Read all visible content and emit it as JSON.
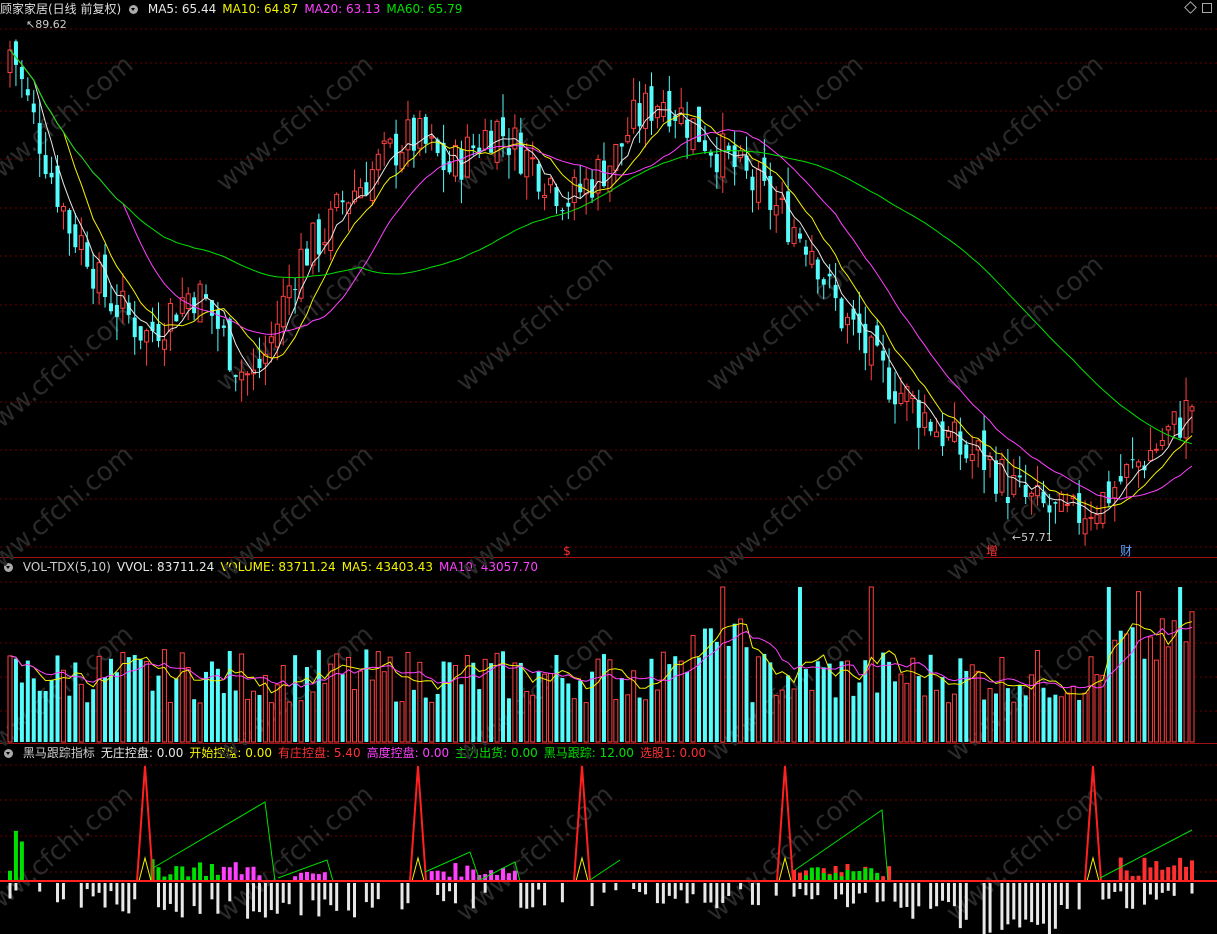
{
  "price_panel": {
    "stock_name": "顾家家居(日线 前复权)",
    "ma_labels": [
      {
        "text": "MA5: 65.44",
        "color": "#e8e8e8"
      },
      {
        "text": "MA10: 64.87",
        "color": "#f4f400"
      },
      {
        "text": "MA20: 63.13",
        "color": "#ff40ff"
      },
      {
        "text": "MA60: 65.79",
        "color": "#00e000"
      }
    ],
    "max_label": "89.62",
    "min_label": "57.71",
    "markers": [
      {
        "text": "$",
        "color": "#ff3030"
      },
      {
        "text": "增",
        "color": "#ff3030"
      },
      {
        "text": "财",
        "color": "#60a0ff"
      }
    ]
  },
  "volume_panel": {
    "labels": [
      {
        "text": "VOL-TDX(5,10)",
        "color": "#cccccc"
      },
      {
        "text": "VVOL: 83711.24",
        "color": "#e8e8e8"
      },
      {
        "text": "VOLUME: 83711.24",
        "color": "#f4f400"
      },
      {
        "text": "MA5: 43403.43",
        "color": "#f4f400"
      },
      {
        "text": "MA10: 43057.70",
        "color": "#ff40ff"
      }
    ]
  },
  "indicator_panel": {
    "labels": [
      {
        "text": "黑马跟踪指标",
        "color": "#cccccc"
      },
      {
        "text": "无庄控盘: 0.00",
        "color": "#e8e8e8"
      },
      {
        "text": "开始控盘: 0.00",
        "color": "#f4f400"
      },
      {
        "text": "有庄控盘: 5.40",
        "color": "#ff3030"
      },
      {
        "text": "高度控盘: 0.00",
        "color": "#ff40ff"
      },
      {
        "text": "主力出货: 0.00",
        "color": "#00e000"
      },
      {
        "text": "黑马跟踪: 12.00",
        "color": "#00e000"
      },
      {
        "text": "选股1: 0.00",
        "color": "#ff3030"
      }
    ]
  },
  "watermark": "www.cfchi.com",
  "colors": {
    "up": "#ff4040",
    "down": "#54fcfc",
    "grid": "#6a0000"
  },
  "chart_data": [
    {
      "type": "candlestick",
      "title": "顾家家居(日线 前复权)",
      "ylim": [
        57,
        91
      ],
      "price_max": 89.62,
      "price_min": 57.71,
      "close_series_approx": [
        89.6,
        86,
        83,
        80,
        77,
        76,
        73,
        72,
        71,
        70,
        71,
        72,
        73,
        72,
        70,
        68,
        67,
        69,
        72,
        75,
        76,
        77,
        79,
        80,
        81,
        82,
        83,
        83,
        82,
        81,
        82,
        83,
        84,
        83,
        82,
        81,
        80,
        79,
        80,
        81,
        82,
        84,
        85,
        86,
        85,
        84,
        83,
        82,
        81,
        80,
        79,
        78,
        77,
        76,
        73,
        71,
        70,
        68,
        67,
        66,
        65,
        64,
        63,
        62,
        62,
        61,
        60,
        59,
        58.5,
        58,
        57.7,
        58.5,
        59,
        60,
        61,
        62,
        63,
        64,
        65.44
      ],
      "moving_averages": {
        "MA5": 65.44,
        "MA10": 64.87,
        "MA20": 63.13,
        "MA60": 65.79
      }
    },
    {
      "type": "bar",
      "title": "VOL-TDX(5,10)",
      "series": [
        {
          "name": "VOLUME",
          "last": 83711.24
        },
        {
          "name": "MA5",
          "last": 43403.43
        },
        {
          "name": "MA10",
          "last": 43057.7
        }
      ]
    },
    {
      "type": "bar",
      "title": "黑马跟踪指标",
      "red_spike_x": [
        145,
        418,
        582,
        785,
        1093
      ],
      "series": [
        {
          "name": "无庄控盘",
          "last": 0.0
        },
        {
          "name": "开始控盘",
          "last": 0.0
        },
        {
          "name": "有庄控盘",
          "last": 5.4
        },
        {
          "name": "高度控盘",
          "last": 0.0
        },
        {
          "name": "主力出货",
          "last": 0.0
        },
        {
          "name": "黑马跟踪",
          "last": 12.0
        },
        {
          "name": "选股1",
          "last": 0.0
        }
      ]
    }
  ]
}
